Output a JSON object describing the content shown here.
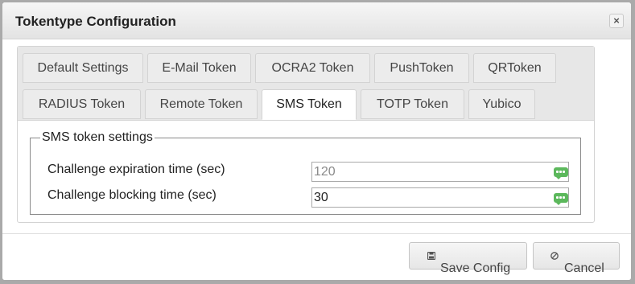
{
  "dialog": {
    "title": "Tokentype Configuration",
    "close_label": "×"
  },
  "tabs": {
    "default_settings": "Default Settings",
    "email": "E-Mail Token",
    "ocra2": "OCRA2 Token",
    "push": "PushToken",
    "qr": "QRToken",
    "radius": "RADIUS Token",
    "remote": "Remote Token",
    "sms": "SMS Token",
    "totp": "TOTP Token",
    "yubico": "Yubico",
    "active": "sms"
  },
  "sms_settings": {
    "legend": "SMS token settings",
    "challenge_expiration": {
      "label": "Challenge expiration time (sec)",
      "value": "",
      "placeholder": "120"
    },
    "challenge_blocking": {
      "label": "Challenge blocking time (sec)",
      "value": "30"
    },
    "field_icon": "chat-bubble-icon"
  },
  "footer": {
    "save_label": "Save Config",
    "save_icon": "save-icon",
    "cancel_label": "Cancel",
    "cancel_icon": "cancel-circle-icon"
  },
  "colors": {
    "field_icon": "#5cb85c",
    "title_bar": "#e9e9e9"
  }
}
